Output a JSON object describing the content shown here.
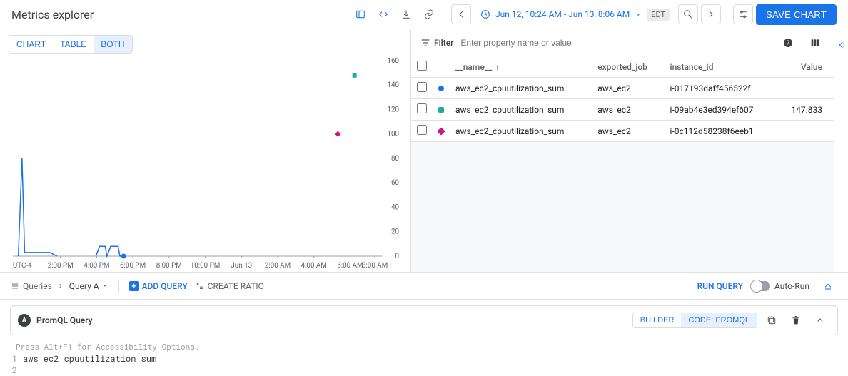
{
  "header": {
    "title": "Metrics explorer",
    "time_range": "Jun 12, 10:24 AM - Jun 13, 8:06 AM",
    "tz": "EDT",
    "save_label": "SAVE CHART"
  },
  "view_toggle": {
    "chart": "CHART",
    "table": "TABLE",
    "both": "BOTH"
  },
  "chart_data": {
    "type": "line",
    "ylim": [
      0,
      160
    ],
    "y_ticks": [
      0,
      20,
      40,
      60,
      80,
      100,
      120,
      140,
      160
    ],
    "x_ticks": [
      "2:00 PM",
      "4:00 PM",
      "6:00 PM",
      "8:00 PM",
      "10:00 PM",
      "Jun 13",
      "2:00 AM",
      "4:00 AM",
      "6:00 AM",
      "8:00 AM"
    ],
    "tz_label": "UTC-4",
    "series": [
      {
        "name": "i-017193daff456522f",
        "color": "#1a73e8",
        "marker": "circle"
      },
      {
        "name": "i-09ab4e3ed394ef607",
        "color": "#1aae9f",
        "marker": "square"
      },
      {
        "name": "i-0c112d58238f6eeb1",
        "color": "#d01884",
        "marker": "diamond"
      }
    ],
    "markers": [
      {
        "series": 1,
        "x_frac": 0.925,
        "y_value": 147.833
      },
      {
        "series": 2,
        "x_frac": 0.88,
        "y_value": 100
      },
      {
        "series": 0,
        "x_frac": 0.3,
        "y_value": 0
      }
    ],
    "line_series0": {
      "spike_x": 0.025,
      "spike_y": 80,
      "bumps_start": 0.235,
      "bumps_end": 0.3,
      "bump_height": 8
    }
  },
  "filter": {
    "label": "Filter",
    "placeholder": "Enter property name or value"
  },
  "table": {
    "columns": {
      "name": "__name__",
      "exported_job": "exported_job",
      "instance_id": "instance_id",
      "value": "Value"
    },
    "rows": [
      {
        "color": "#1a73e8",
        "marker": "circle",
        "name": "aws_ec2_cpuutilization_sum",
        "job": "aws_ec2",
        "instance": "i-017193daff456522f",
        "value": "–"
      },
      {
        "color": "#1aae9f",
        "marker": "square",
        "name": "aws_ec2_cpuutilization_sum",
        "job": "aws_ec2",
        "instance": "i-09ab4e3ed394ef607",
        "value": "147.833"
      },
      {
        "color": "#d01884",
        "marker": "diamond",
        "name": "aws_ec2_cpuutilization_sum",
        "job": "aws_ec2",
        "instance": "i-0c112d58238f6eeb1",
        "value": "–"
      }
    ]
  },
  "query_bar": {
    "queries_label": "Queries",
    "current_query": "Query A",
    "add_query": "ADD QUERY",
    "create_ratio": "CREATE RATIO",
    "run_query": "RUN QUERY",
    "auto_run": "Auto-Run"
  },
  "promql": {
    "badge": "A",
    "title": "PromQL Query",
    "builder": "BUILDER",
    "code": "CODE: PROMQL",
    "hint": "Press Alt+F1 for Accessibility Options.",
    "line1_no": "1",
    "line2_no": "2",
    "line1_txt": "aws_ec2_cpuutilization_sum"
  }
}
